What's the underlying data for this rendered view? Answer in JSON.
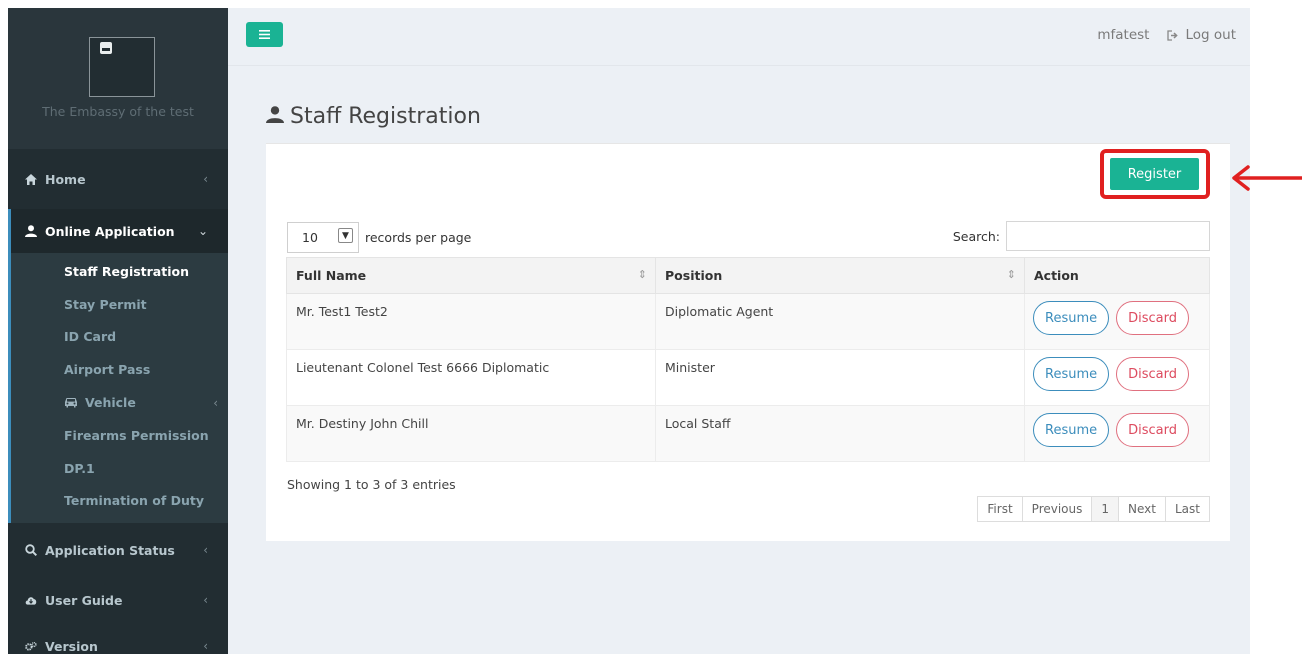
{
  "sidebar": {
    "brand_name": "The Embassy of the test",
    "items": {
      "home": {
        "label": "Home",
        "icon": "home-icon"
      },
      "online_application": {
        "label": "Online Application",
        "icon": "user-icon"
      },
      "application_status": {
        "label": "Application Status",
        "icon": "search-icon"
      },
      "user_guide": {
        "label": "User Guide",
        "icon": "cloud-download-icon"
      },
      "version": {
        "label": "Version",
        "icon": "gears-icon"
      }
    },
    "submenu": [
      {
        "label": "Staff Registration",
        "active": true
      },
      {
        "label": "Stay Permit"
      },
      {
        "label": "ID Card"
      },
      {
        "label": "Airport Pass"
      },
      {
        "label": "Vehicle",
        "icon": "car-icon"
      },
      {
        "label": "Firearms Permission"
      },
      {
        "label": "DP.1"
      },
      {
        "label": "Termination of Duty"
      }
    ]
  },
  "header": {
    "username": "mfatest",
    "logout_label": "Log out"
  },
  "page": {
    "title": "Staff Registration",
    "register_label": "Register"
  },
  "table_controls": {
    "page_length": "10",
    "page_length_suffix": "records per page",
    "search_label": "Search:",
    "search_value": ""
  },
  "table": {
    "columns": [
      "Full Name",
      "Position",
      "Action"
    ],
    "rows": [
      {
        "full_name": "Mr. Test1 Test2",
        "position": "Diplomatic Agent"
      },
      {
        "full_name": "Lieutenant Colonel Test 6666 Diplomatic",
        "position": "Minister"
      },
      {
        "full_name": "Mr. Destiny John Chill",
        "position": "Local Staff"
      }
    ],
    "resume_label": "Resume",
    "discard_label": "Discard"
  },
  "footer": {
    "info": "Showing 1 to 3 of 3 entries",
    "pagination": {
      "first": "First",
      "previous": "Previous",
      "current": "1",
      "next": "Next",
      "last": "Last"
    }
  },
  "colors": {
    "accent_green": "#1ab394",
    "sidebar_bg": "#222d32",
    "highlight_red": "#e02020",
    "resume_blue": "#3c8dbc",
    "discard_red": "#dd4b5f"
  }
}
